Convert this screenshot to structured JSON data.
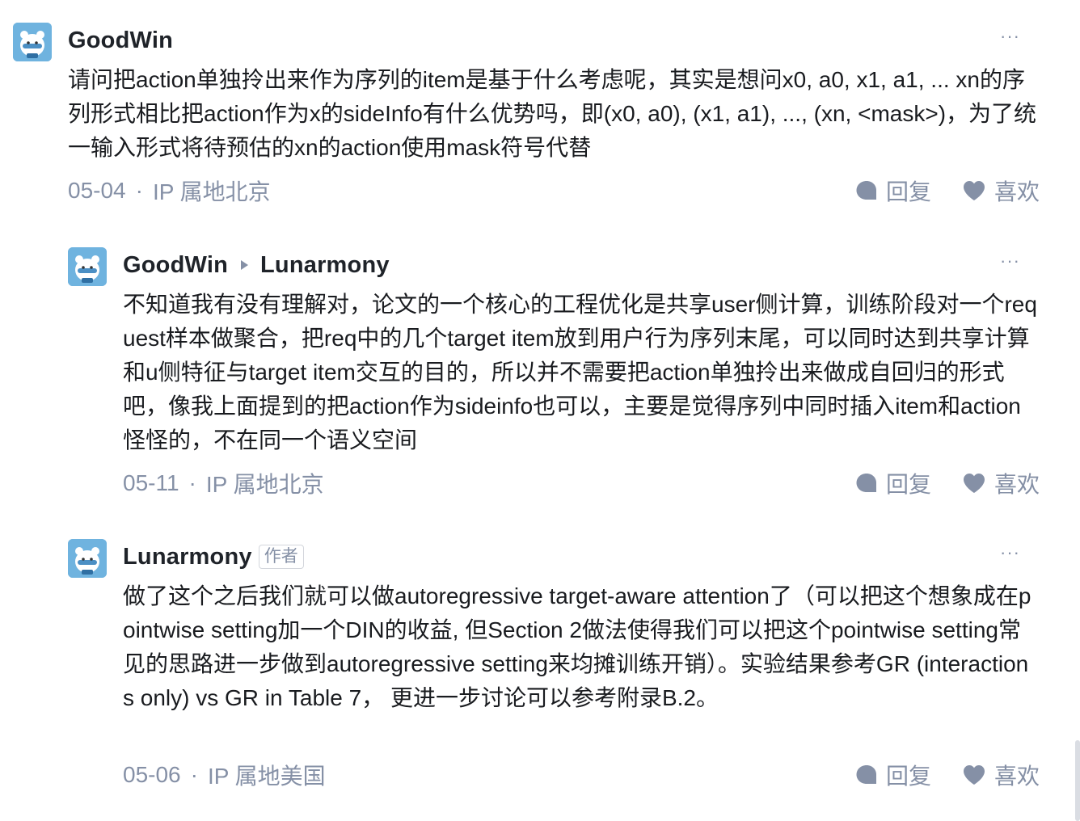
{
  "comments": [
    {
      "user": "GoodWin",
      "text": "请问把action单独拎出来作为序列的item是基于什么考虑呢，其实是想问x0, a0, x1, a1, ... xn的序列形式相比把action作为x的sideInfo有什么优势吗，即(x0, a0), (x1, a1), ..., (xn, <mask>)，为了统一输入形式将待预估的xn的action使用mask符号代替",
      "date": "05-04",
      "location": "IP 属地北京"
    },
    {
      "user": "GoodWin",
      "reply_to": "Lunarmony",
      "text": "不知道我有没有理解对，论文的一个核心的工程优化是共享user侧计算，训练阶段对一个request样本做聚合，把req中的几个target item放到用户行为序列末尾，可以同时达到共享计算和u侧特征与target item交互的目的，所以并不需要把action单独拎出来做成自回归的形式吧，像我上面提到的把action作为sideinfo也可以，主要是觉得序列中同时插入item和action怪怪的，不在同一个语义空间",
      "date": "05-11",
      "location": "IP 属地北京"
    },
    {
      "user": "Lunarmony",
      "badge": "作者",
      "text": "做了这个之后我们就可以做autoregressive target-aware attention了（可以把这个想象成在pointwise setting加一个DIN的收益, 但Section 2做法使得我们可以把这个pointwise setting常见的思路进一步做到autoregressive setting来均摊训练开销）。实验结果参考GR (interactions only) vs GR in Table 7， 更进一步讨论可以参考附录B.2。",
      "date": "05-06",
      "location": "IP 属地美国"
    }
  ],
  "labels": {
    "more": "···",
    "separator": "·",
    "reply": "回复",
    "like": "喜欢"
  },
  "icons": {
    "avatar": "bear-avatar-icon",
    "more": "more-dots-icon",
    "reply_arrow": "triangle-right-icon",
    "reply": "chat-bubble-icon",
    "like": "heart-icon"
  },
  "colors": {
    "text": "#191b1f",
    "meta": "#8590a6",
    "avatar_bg": "#6fb3df"
  }
}
